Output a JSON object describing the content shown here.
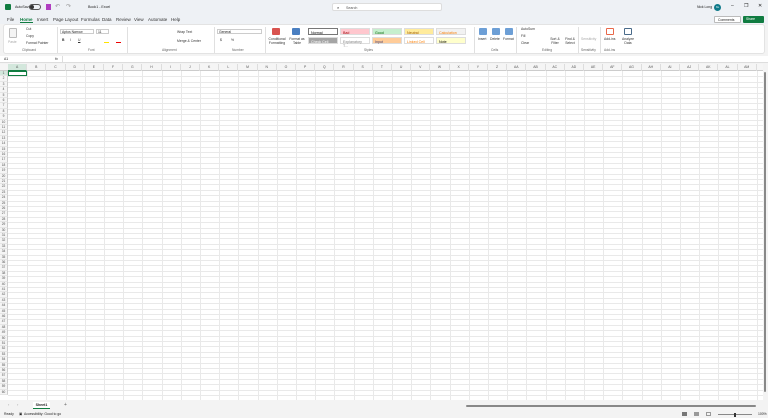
{
  "titlebar": {
    "autosave": "AutoSave",
    "autosave_state": "Off",
    "doc_title": "Book1  -  Excel",
    "search_placeholder": "Search",
    "user": "Nick Long",
    "avatar_initials": "NL"
  },
  "menu": {
    "tabs": [
      "File",
      "Home",
      "Insert",
      "Page Layout",
      "Formulas",
      "Data",
      "Review",
      "View",
      "Automate",
      "Help"
    ],
    "comments": "Comments",
    "share": "Share"
  },
  "ribbon": {
    "clipboard": {
      "paste": "Paste",
      "cut": "Cut",
      "copy": "Copy",
      "format_painter": "Format Painter",
      "label": "Clipboard"
    },
    "font": {
      "name": "Aptos Narrow",
      "size": "11",
      "label": "Font"
    },
    "alignment": {
      "wrap": "Wrap Text",
      "merge": "Merge & Center",
      "label": "Alignment"
    },
    "number": {
      "format": "General",
      "label": "Number"
    },
    "styles": {
      "conditional": "Conditional Formatting",
      "format_table": "Format as Table",
      "label": "Styles",
      "cells": [
        {
          "name": "Normal",
          "bg": "#ffffff",
          "fg": "#000000"
        },
        {
          "name": "Bad",
          "bg": "#ffc7ce",
          "fg": "#9c0006"
        },
        {
          "name": "Good",
          "bg": "#c6efce",
          "fg": "#006100"
        },
        {
          "name": "Neutral",
          "bg": "#ffeb9c",
          "fg": "#9c5700"
        },
        {
          "name": "Calculation",
          "bg": "#f2f2f2",
          "fg": "#fa7d00"
        },
        {
          "name": "Check Cell",
          "bg": "#a5a5a5",
          "fg": "#ffffff"
        },
        {
          "name": "Explanatory T...",
          "bg": "#ffffff",
          "fg": "#7f7f7f"
        },
        {
          "name": "Input",
          "bg": "#ffcc99",
          "fg": "#3f3f76"
        },
        {
          "name": "Linked Cell",
          "bg": "#ffffff",
          "fg": "#fa7d00"
        },
        {
          "name": "Note",
          "bg": "#ffffcc",
          "fg": "#000000"
        }
      ]
    },
    "cells": {
      "insert": "Insert",
      "delete": "Delete",
      "format": "Format",
      "label": "Cells"
    },
    "editing": {
      "autosum": "AutoSum",
      "fill": "Fill",
      "clear": "Clear",
      "sort": "Sort & Filter",
      "find": "Find & Select",
      "label": "Editing"
    },
    "sensitivity": {
      "btn": "Sensitivity",
      "label": "Sensitivity"
    },
    "addins": {
      "btn": "Add-ins",
      "analyze": "Analyze Data",
      "label": "Add-ins"
    }
  },
  "formula_bar": {
    "name_box": "A1",
    "fx": "fx",
    "value": ""
  },
  "grid": {
    "columns": [
      "A",
      "B",
      "C",
      "D",
      "E",
      "F",
      "G",
      "H",
      "I",
      "J",
      "K",
      "L",
      "M",
      "N",
      "O",
      "P",
      "Q",
      "R",
      "S",
      "T",
      "U",
      "V",
      "W",
      "X",
      "Y",
      "Z",
      "AA",
      "AB",
      "AC",
      "AD",
      "AE",
      "AF",
      "AG",
      "AH",
      "AI",
      "AJ",
      "AK",
      "AL",
      "AM"
    ],
    "row_count": 60,
    "selected": "A1"
  },
  "sheets": {
    "tabs": [
      "Sheet1"
    ],
    "add": "+"
  },
  "status": {
    "ready": "Ready",
    "accessibility": "Accessibility: Good to go",
    "zoom": "100%"
  }
}
